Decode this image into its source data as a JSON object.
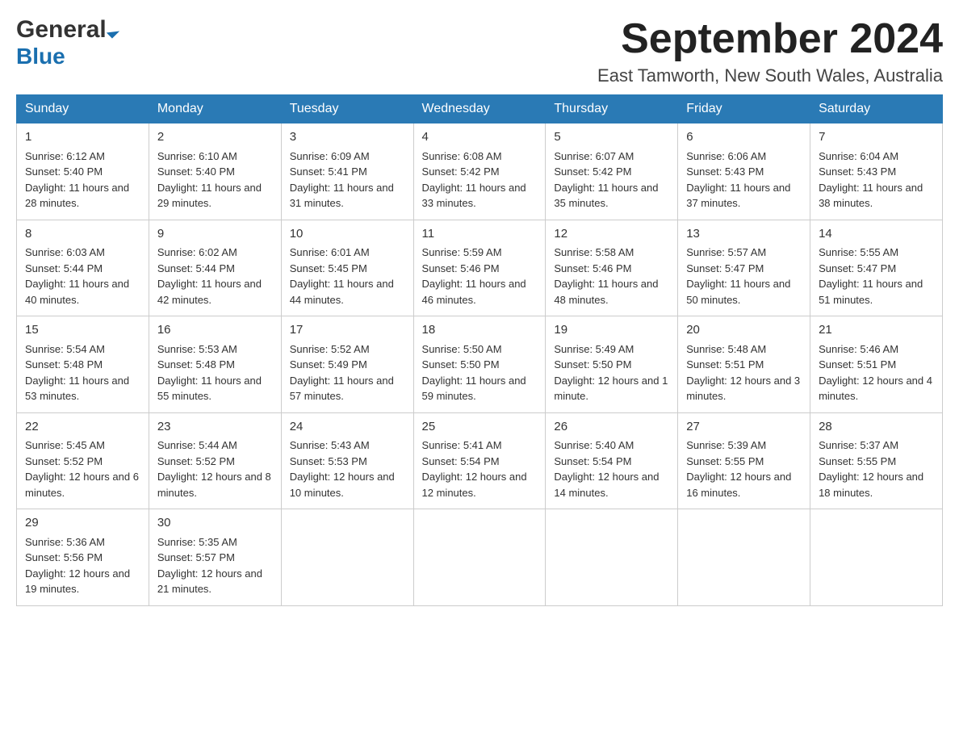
{
  "logo": {
    "line1": "General",
    "arrow": "▶",
    "line2": "Blue"
  },
  "title": {
    "month_year": "September 2024",
    "location": "East Tamworth, New South Wales, Australia"
  },
  "days_of_week": [
    "Sunday",
    "Monday",
    "Tuesday",
    "Wednesday",
    "Thursday",
    "Friday",
    "Saturday"
  ],
  "weeks": [
    [
      {
        "day": "1",
        "sunrise": "6:12 AM",
        "sunset": "5:40 PM",
        "daylight": "11 hours and 28 minutes."
      },
      {
        "day": "2",
        "sunrise": "6:10 AM",
        "sunset": "5:40 PM",
        "daylight": "11 hours and 29 minutes."
      },
      {
        "day": "3",
        "sunrise": "6:09 AM",
        "sunset": "5:41 PM",
        "daylight": "11 hours and 31 minutes."
      },
      {
        "day": "4",
        "sunrise": "6:08 AM",
        "sunset": "5:42 PM",
        "daylight": "11 hours and 33 minutes."
      },
      {
        "day": "5",
        "sunrise": "6:07 AM",
        "sunset": "5:42 PM",
        "daylight": "11 hours and 35 minutes."
      },
      {
        "day": "6",
        "sunrise": "6:06 AM",
        "sunset": "5:43 PM",
        "daylight": "11 hours and 37 minutes."
      },
      {
        "day": "7",
        "sunrise": "6:04 AM",
        "sunset": "5:43 PM",
        "daylight": "11 hours and 38 minutes."
      }
    ],
    [
      {
        "day": "8",
        "sunrise": "6:03 AM",
        "sunset": "5:44 PM",
        "daylight": "11 hours and 40 minutes."
      },
      {
        "day": "9",
        "sunrise": "6:02 AM",
        "sunset": "5:44 PM",
        "daylight": "11 hours and 42 minutes."
      },
      {
        "day": "10",
        "sunrise": "6:01 AM",
        "sunset": "5:45 PM",
        "daylight": "11 hours and 44 minutes."
      },
      {
        "day": "11",
        "sunrise": "5:59 AM",
        "sunset": "5:46 PM",
        "daylight": "11 hours and 46 minutes."
      },
      {
        "day": "12",
        "sunrise": "5:58 AM",
        "sunset": "5:46 PM",
        "daylight": "11 hours and 48 minutes."
      },
      {
        "day": "13",
        "sunrise": "5:57 AM",
        "sunset": "5:47 PM",
        "daylight": "11 hours and 50 minutes."
      },
      {
        "day": "14",
        "sunrise": "5:55 AM",
        "sunset": "5:47 PM",
        "daylight": "11 hours and 51 minutes."
      }
    ],
    [
      {
        "day": "15",
        "sunrise": "5:54 AM",
        "sunset": "5:48 PM",
        "daylight": "11 hours and 53 minutes."
      },
      {
        "day": "16",
        "sunrise": "5:53 AM",
        "sunset": "5:48 PM",
        "daylight": "11 hours and 55 minutes."
      },
      {
        "day": "17",
        "sunrise": "5:52 AM",
        "sunset": "5:49 PM",
        "daylight": "11 hours and 57 minutes."
      },
      {
        "day": "18",
        "sunrise": "5:50 AM",
        "sunset": "5:50 PM",
        "daylight": "11 hours and 59 minutes."
      },
      {
        "day": "19",
        "sunrise": "5:49 AM",
        "sunset": "5:50 PM",
        "daylight": "12 hours and 1 minute."
      },
      {
        "day": "20",
        "sunrise": "5:48 AM",
        "sunset": "5:51 PM",
        "daylight": "12 hours and 3 minutes."
      },
      {
        "day": "21",
        "sunrise": "5:46 AM",
        "sunset": "5:51 PM",
        "daylight": "12 hours and 4 minutes."
      }
    ],
    [
      {
        "day": "22",
        "sunrise": "5:45 AM",
        "sunset": "5:52 PM",
        "daylight": "12 hours and 6 minutes."
      },
      {
        "day": "23",
        "sunrise": "5:44 AM",
        "sunset": "5:52 PM",
        "daylight": "12 hours and 8 minutes."
      },
      {
        "day": "24",
        "sunrise": "5:43 AM",
        "sunset": "5:53 PM",
        "daylight": "12 hours and 10 minutes."
      },
      {
        "day": "25",
        "sunrise": "5:41 AM",
        "sunset": "5:54 PM",
        "daylight": "12 hours and 12 minutes."
      },
      {
        "day": "26",
        "sunrise": "5:40 AM",
        "sunset": "5:54 PM",
        "daylight": "12 hours and 14 minutes."
      },
      {
        "day": "27",
        "sunrise": "5:39 AM",
        "sunset": "5:55 PM",
        "daylight": "12 hours and 16 minutes."
      },
      {
        "day": "28",
        "sunrise": "5:37 AM",
        "sunset": "5:55 PM",
        "daylight": "12 hours and 18 minutes."
      }
    ],
    [
      {
        "day": "29",
        "sunrise": "5:36 AM",
        "sunset": "5:56 PM",
        "daylight": "12 hours and 19 minutes."
      },
      {
        "day": "30",
        "sunrise": "5:35 AM",
        "sunset": "5:57 PM",
        "daylight": "12 hours and 21 minutes."
      },
      null,
      null,
      null,
      null,
      null
    ]
  ],
  "labels": {
    "sunrise": "Sunrise:",
    "sunset": "Sunset:",
    "daylight": "Daylight:"
  }
}
